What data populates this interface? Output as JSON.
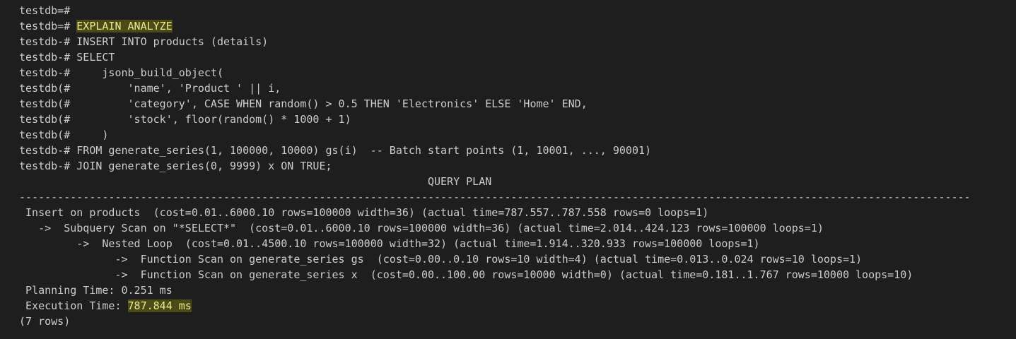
{
  "terminal": {
    "lines": [
      {
        "prompt": "testdb=#",
        "text": ""
      },
      {
        "prompt": "testdb=# ",
        "text": "EXPLAIN ANALYZE"
      },
      {
        "prompt": "testdb-# ",
        "text": "INSERT INTO products (details)"
      },
      {
        "prompt": "testdb-# ",
        "text": "SELECT"
      },
      {
        "prompt": "testdb-# ",
        "text": "    jsonb_build_object("
      },
      {
        "prompt": "testdb(# ",
        "text": "        'name', 'Product ' || i,"
      },
      {
        "prompt": "testdb(# ",
        "text": "        'category', CASE WHEN random() > 0.5 THEN 'Electronics' ELSE 'Home' END,"
      },
      {
        "prompt": "testdb(# ",
        "text": "        'stock', floor(random() * 1000 + 1)"
      },
      {
        "prompt": "testdb(# ",
        "text": "    )"
      },
      {
        "prompt": "testdb-# ",
        "text": "FROM generate_series(1, 100000, 10000) gs(i)  -- Batch start points (1, 10001, ..., 90001)"
      },
      {
        "prompt": "testdb-# ",
        "text": "JOIN generate_series(0, 9999) x ON TRUE;"
      }
    ],
    "plan_header": "                                                                QUERY PLAN",
    "plan_separator": "-----------------------------------------------------------------------------------------------------------------------------------------------------",
    "plan_lines": [
      " Insert on products  (cost=0.01..6000.10 rows=100000 width=36) (actual time=787.557..787.558 rows=0 loops=1)",
      "   ->  Subquery Scan on \"*SELECT*\"  (cost=0.01..6000.10 rows=100000 width=36) (actual time=2.014..424.123 rows=100000 loops=1)",
      "         ->  Nested Loop  (cost=0.01..4500.10 rows=100000 width=32) (actual time=1.914..320.933 rows=100000 loops=1)",
      "               ->  Function Scan on generate_series gs  (cost=0.00..0.10 rows=10 width=4) (actual time=0.013..0.024 rows=10 loops=1)",
      "               ->  Function Scan on generate_series x  (cost=0.00..100.00 rows=10000 width=0) (actual time=0.181..1.767 rows=10000 loops=10)",
      " Planning Time: 0.251 ms"
    ],
    "execution_time_label": " Execution Time: ",
    "execution_time_value": "787.844 ms",
    "row_count": "(7 rows)"
  },
  "colors": {
    "background": "#1e1e1e",
    "text": "#cccccc",
    "highlight_bg": "#4b4b18",
    "highlight_fg": "#ece98f"
  }
}
